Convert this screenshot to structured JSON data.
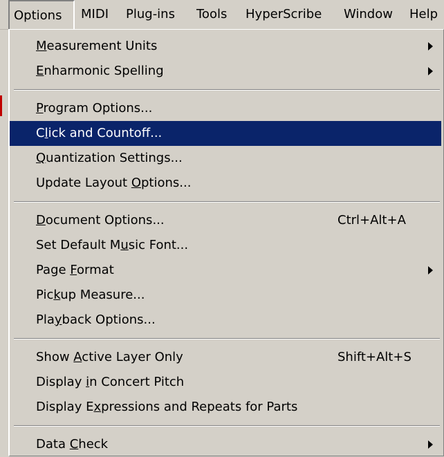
{
  "menubar": {
    "items": [
      "Options",
      "MIDI",
      "Plug-ins",
      "Tools",
      "HyperScribe",
      "Window",
      "Help"
    ]
  },
  "menu": {
    "highlight_color": "#0a246a",
    "items": [
      {
        "pre": "",
        "key": "M",
        "post": "easurement Units",
        "shortcut": "",
        "submenu": true
      },
      {
        "pre": "",
        "key": "E",
        "post": "nharmonic Spelling",
        "shortcut": "",
        "submenu": true
      },
      {
        "pre": "",
        "key": "P",
        "post": "rogram Options...",
        "shortcut": "",
        "submenu": false
      },
      {
        "pre": "C",
        "key": "l",
        "post": "ick and Countoff...",
        "shortcut": "",
        "submenu": false,
        "highlighted": true
      },
      {
        "pre": "",
        "key": "Q",
        "post": "uantization Settings...",
        "shortcut": "",
        "submenu": false
      },
      {
        "pre": "Update Layout ",
        "key": "O",
        "post": "ptions...",
        "shortcut": "",
        "submenu": false
      },
      {
        "pre": "",
        "key": "D",
        "post": "ocument Options...",
        "shortcut": "Ctrl+Alt+A",
        "submenu": false
      },
      {
        "pre": "Set Default M",
        "key": "u",
        "post": "sic Font...",
        "shortcut": "",
        "submenu": false
      },
      {
        "pre": "Page ",
        "key": "F",
        "post": "ormat",
        "shortcut": "",
        "submenu": true
      },
      {
        "pre": "Pic",
        "key": "k",
        "post": "up Measure...",
        "shortcut": "",
        "submenu": false
      },
      {
        "pre": "Pla",
        "key": "y",
        "post": "back Options...",
        "shortcut": "",
        "submenu": false
      },
      {
        "pre": "Show ",
        "key": "A",
        "post": "ctive Layer Only",
        "shortcut": "Shift+Alt+S",
        "submenu": false
      },
      {
        "pre": "Display ",
        "key": "i",
        "post": "n Concert Pitch",
        "shortcut": "",
        "submenu": false
      },
      {
        "pre": "Display E",
        "key": "x",
        "post": "pressions and Repeats for Parts",
        "shortcut": "",
        "submenu": false
      },
      {
        "pre": "Data ",
        "key": "C",
        "post": "heck",
        "shortcut": "",
        "submenu": true
      }
    ]
  }
}
